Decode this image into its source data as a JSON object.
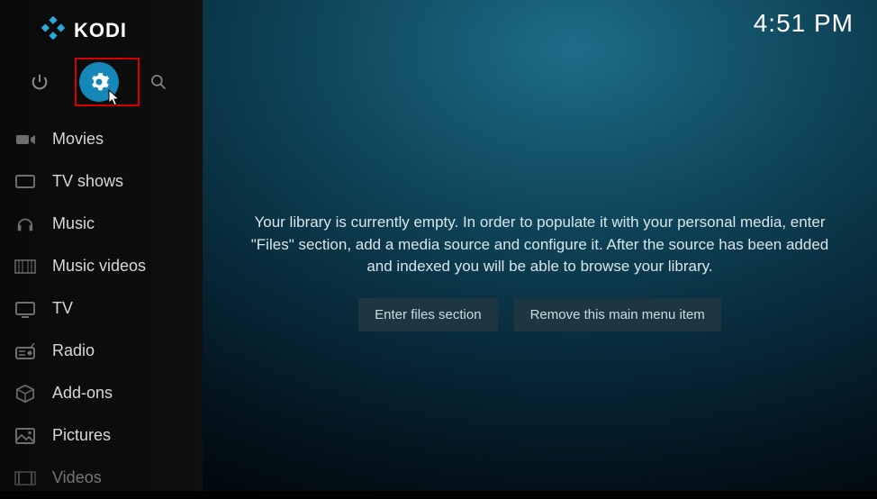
{
  "header": {
    "app_name": "KODI",
    "clock": "4:51 PM"
  },
  "sidebar": {
    "items": [
      {
        "label": "Movies",
        "icon": "movies-icon"
      },
      {
        "label": "TV shows",
        "icon": "tvshows-icon"
      },
      {
        "label": "Music",
        "icon": "music-icon"
      },
      {
        "label": "Music videos",
        "icon": "musicvideos-icon"
      },
      {
        "label": "TV",
        "icon": "tv-icon"
      },
      {
        "label": "Radio",
        "icon": "radio-icon"
      },
      {
        "label": "Add-ons",
        "icon": "addons-icon"
      },
      {
        "label": "Pictures",
        "icon": "pictures-icon"
      },
      {
        "label": "Videos",
        "icon": "videos-icon",
        "dim": true
      }
    ]
  },
  "main": {
    "empty_message": "Your library is currently empty. In order to populate it with your personal media, enter \"Files\" section, add a media source and configure it. After the source has been added and indexed you will be able to browse your library.",
    "buttons": {
      "enter_files": "Enter files section",
      "remove_item": "Remove this main menu item"
    }
  }
}
